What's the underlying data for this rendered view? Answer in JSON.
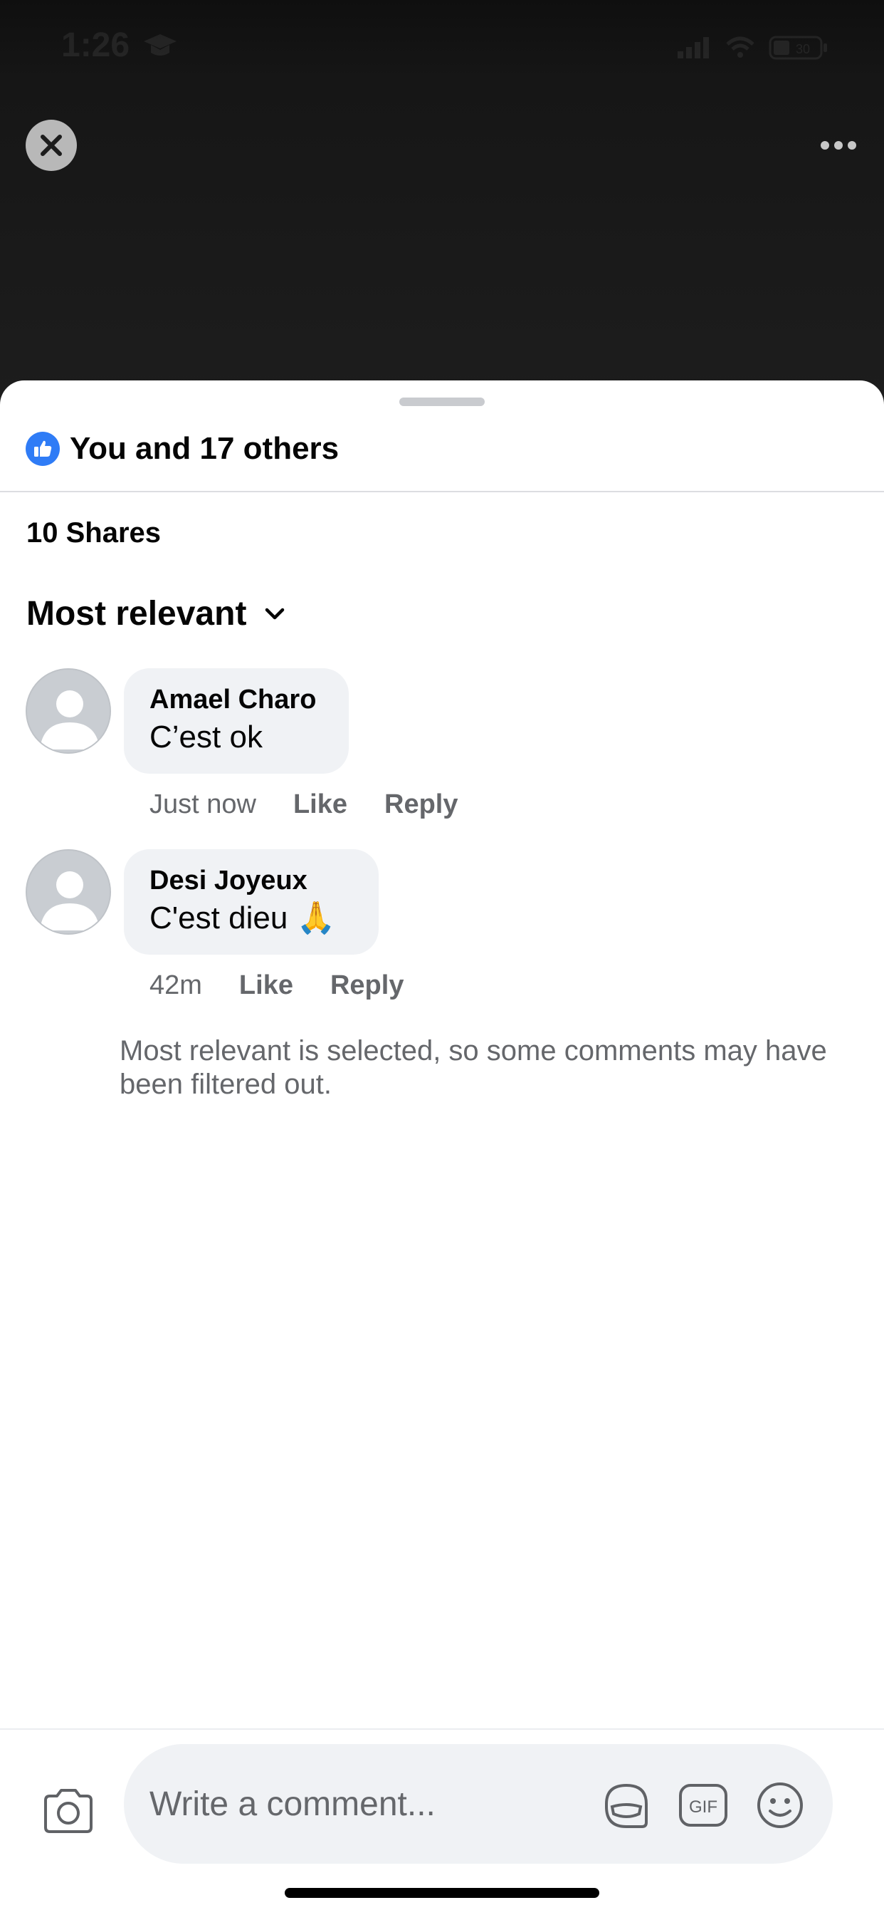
{
  "status_bar": {
    "time": "1:26",
    "battery": "30"
  },
  "header": {
    "close_icon": "close-x-icon",
    "more_icon": "more-horizontal-icon"
  },
  "reactions": {
    "icon": "like-thumb-icon",
    "summary": "You and 17 others"
  },
  "shares": {
    "label": "10 Shares"
  },
  "sort": {
    "label": "Most relevant",
    "icon": "chevron-down-icon"
  },
  "comments": [
    {
      "author": "Amael Charo",
      "text": "C’est ok",
      "time": "Just now",
      "like_label": "Like",
      "reply_label": "Reply"
    },
    {
      "author": "Desi Joyeux",
      "text": "C'est dieu 🙏",
      "time": "42m",
      "like_label": "Like",
      "reply_label": "Reply"
    }
  ],
  "filter_note": "Most relevant is selected, so some comments may have been filtered out.",
  "composer": {
    "placeholder": "Write a comment...",
    "icons": [
      "camera-icon",
      "avatar-sticker-icon",
      "gif-icon",
      "emoji-icon"
    ]
  },
  "colors": {
    "accent": "#2f7cf6",
    "meta_text": "#65676b",
    "bubble_bg": "#f0f2f5"
  }
}
